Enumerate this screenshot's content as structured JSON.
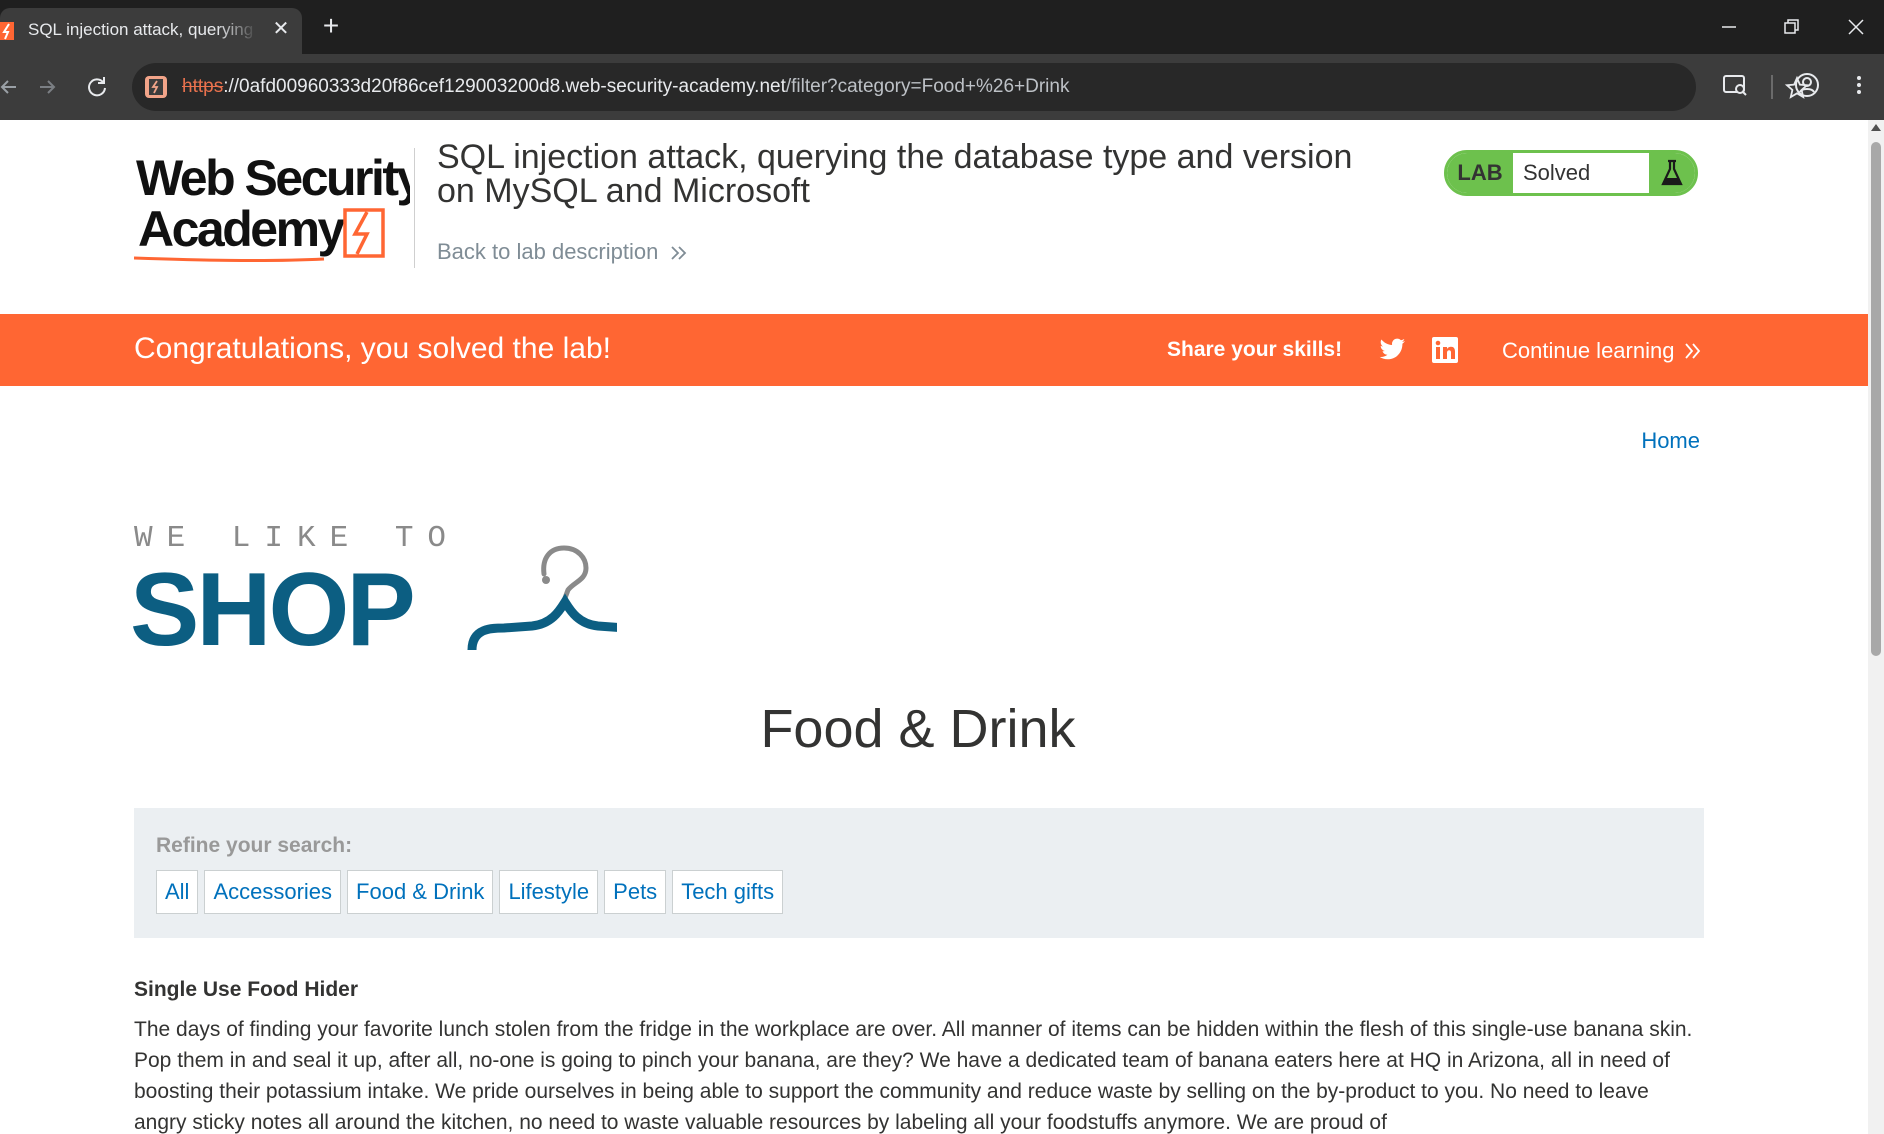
{
  "browser": {
    "tab_title": "SQL injection attack, querying the database type and version on MySQL and Microsoft",
    "new_tab_symbol": "+",
    "close_symbol": "✕",
    "url_scheme": "https",
    "url_host": "://0afd00960333d20f86cef129003200d8.web-security-academy.net",
    "url_path": "/filter?category=Food+%26+Drink"
  },
  "header": {
    "logo_text": "Web Security Academy",
    "lab_title": "SQL injection attack, querying the database type and version on MySQL and Microsoft",
    "back_link": "Back to lab description",
    "lab_badge": "LAB",
    "lab_status": "Solved"
  },
  "banner": {
    "message": "Congratulations, you solved the lab!",
    "share_label": "Share your skills!",
    "continue_label": "Continue learning"
  },
  "nav": {
    "home": "Home"
  },
  "shop_logo": {
    "tagline": "WE LIKE TO",
    "word": "SHOP"
  },
  "page": {
    "heading": "Food & Drink"
  },
  "filter": {
    "label": "Refine your search:",
    "categories": [
      "All",
      "Accessories",
      "Food & Drink",
      "Lifestyle",
      "Pets",
      "Tech gifts"
    ]
  },
  "product": {
    "title": "Single Use Food Hider",
    "description": "The days of finding your favorite lunch stolen from the fridge in the workplace are over. All manner of items can be hidden within the flesh of this single-use banana skin. Pop them in and seal it up, after all, no-one is going to pinch your banana, are they? We have a dedicated team of banana eaters here at HQ in Arizona, all in need of boosting their potassium intake. We pride ourselves in being able to support the community and reduce waste by selling on the by-product to you. No need to leave angry sticky notes all around the kitchen, no need to waste valuable resources by labeling all your foodstuffs anymore. We are proud of"
  },
  "colors": {
    "brand_orange": "#ff6633",
    "lab_green": "#6dc14d",
    "link_blue": "#0071bc",
    "shop_blue": "#0c5e82"
  }
}
